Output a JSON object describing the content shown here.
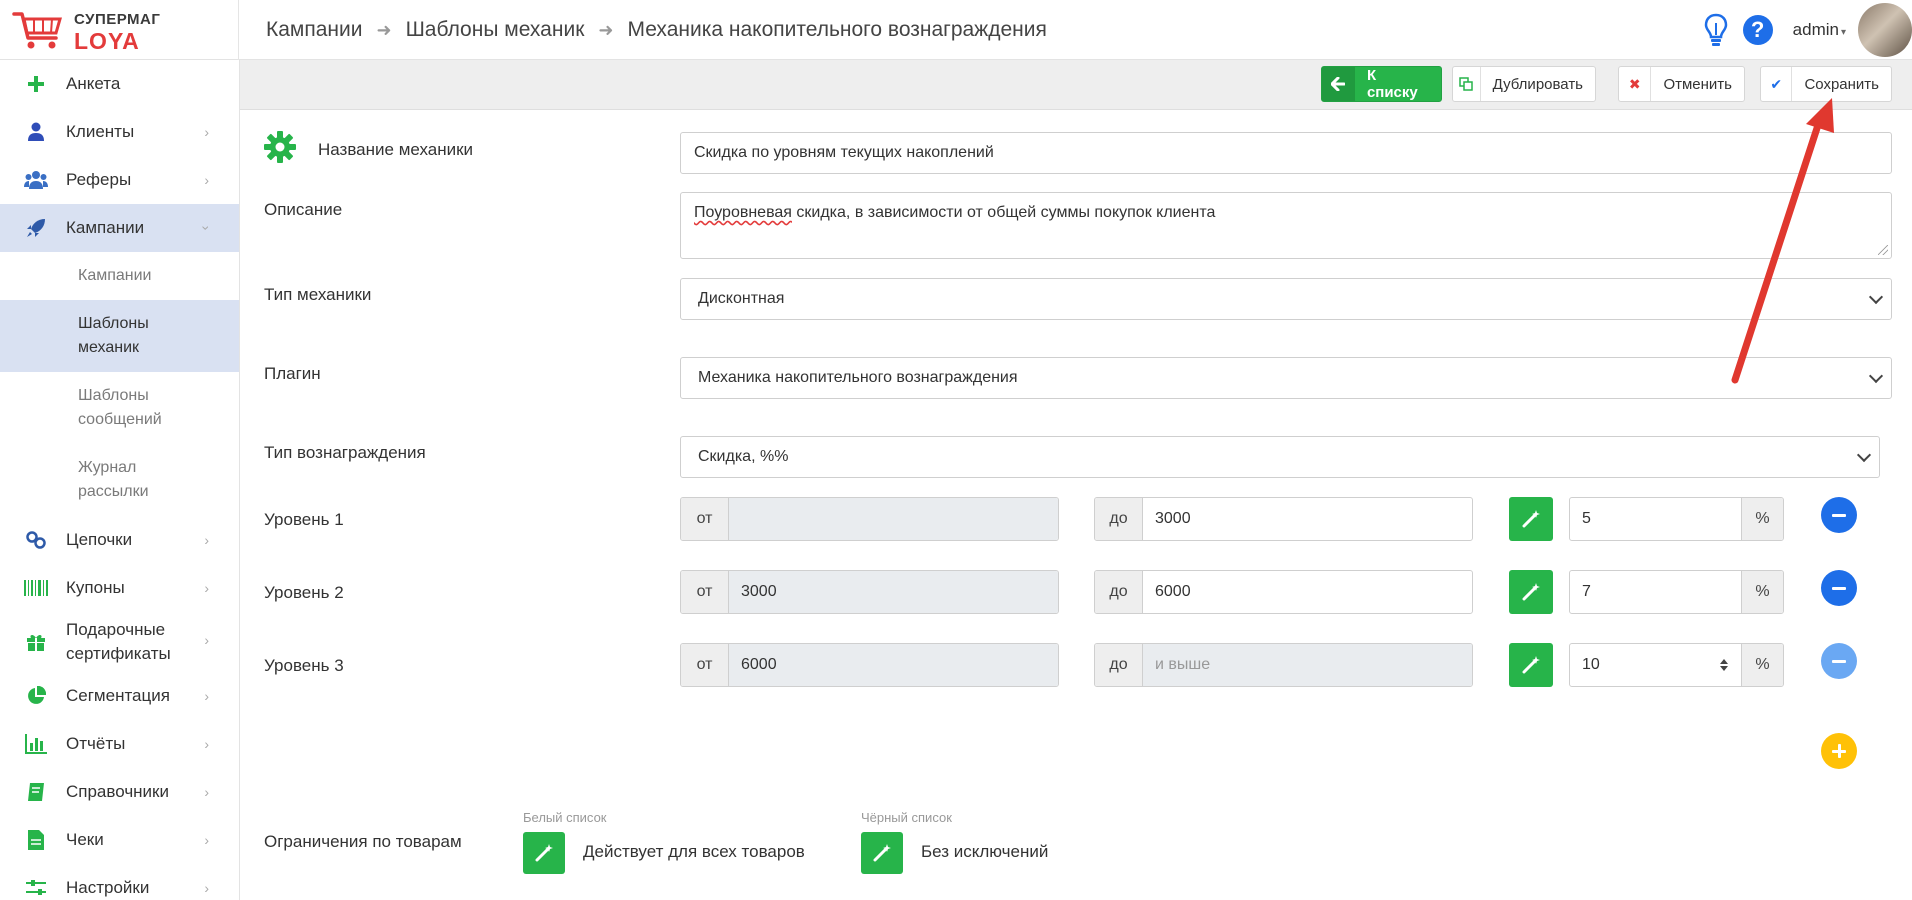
{
  "header": {
    "logo_line1": "СУПЕРМАГ",
    "logo_line2": "LOYA",
    "breadcrumb": [
      "Кампании",
      "Шаблоны механик",
      "Механика накопительного вознаграждения"
    ],
    "help_label": "?",
    "user": "admin",
    "accent": "#e33b3b"
  },
  "sidebar": {
    "items": [
      {
        "label": "Анкета",
        "icon": "plus-icon"
      },
      {
        "label": "Клиенты",
        "icon": "user-icon"
      },
      {
        "label": "Реферы",
        "icon": "users-icon"
      },
      {
        "label": "Кампании",
        "icon": "rocket-icon"
      },
      {
        "label": "Цепочки",
        "icon": "link-icon"
      },
      {
        "label": "Купоны",
        "icon": "barcode-icon"
      },
      {
        "label": "Подарочные сертификаты",
        "icon": "gift-icon"
      },
      {
        "label": "Сегментация",
        "icon": "pie-icon"
      },
      {
        "label": "Отчёты",
        "icon": "bar-chart-icon"
      },
      {
        "label": "Справочники",
        "icon": "book-icon"
      },
      {
        "label": "Чеки",
        "icon": "receipt-icon"
      },
      {
        "label": "Настройки",
        "icon": "sliders-icon"
      }
    ],
    "sub": [
      "Кампании",
      "Шаблоны механик",
      "Шаблоны сообщений",
      "Журнал рассылки"
    ]
  },
  "toolbar": {
    "to_list": "К списку",
    "duplicate": "Дублировать",
    "cancel": "Отменить",
    "save": "Сохранить"
  },
  "form": {
    "name_label": "Название механики",
    "name_value": "Скидка по уровням текущих накоплений",
    "desc_label": "Описание",
    "desc_word": "Поуровневая",
    "desc_rest": " скидка, в зависимости от общей суммы покупок клиента",
    "type_label": "Тип механики",
    "type_value": "Дисконтная",
    "plugin_label": "Плагин",
    "plugin_value": "Механика накопительного вознаграждения",
    "reward_label": "Тип вознаграждения",
    "reward_value": "Скидка, %%",
    "from_label": "от",
    "to_label": "до",
    "pct_label": "%",
    "levels": [
      {
        "name": "Уровень 1",
        "from": "",
        "to": "3000",
        "value": "5"
      },
      {
        "name": "Уровень 2",
        "from": "3000",
        "to": "6000",
        "value": "7"
      },
      {
        "name": "Уровень 3",
        "from": "6000",
        "to_placeholder": "и выше",
        "value": "10"
      }
    ],
    "restrictions_label": "Ограничения по товарам",
    "white_caption": "Белый список",
    "white_value": "Действует для всех товаров",
    "black_caption": "Чёрный список",
    "black_value": "Без исключений"
  }
}
